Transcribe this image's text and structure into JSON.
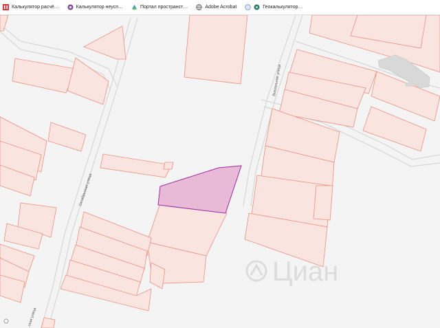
{
  "bookmarks": [
    {
      "label": "Калькулятор расчё…",
      "icon": "red-pdf-icon",
      "color": "#d62f2f"
    },
    {
      "label": "Калькулятор неусп…",
      "icon": "seal-icon",
      "color": "#7a4a8a"
    },
    {
      "label": "Портал пространст…",
      "icon": "cadastre-portal-icon",
      "color": "#3aa0c8"
    },
    {
      "label": "Adobe Acrobat",
      "icon": "globe-icon",
      "color": "#5f6368"
    },
    {
      "label": "Геокалькулятор…",
      "icon": "geocalc-icon",
      "color": "#2e7d6b"
    }
  ],
  "map": {
    "streets": [
      {
        "label": "Октябрьская улица"
      },
      {
        "label": "Вокзальная улица"
      },
      {
        "label": "…ская улица"
      }
    ],
    "watermark": "Циан",
    "colors": {
      "parcel_fill": "#f9e4e0",
      "parcel_stroke": "#ee8e7e",
      "selected_fill": "#e8bad8",
      "selected_stroke": "#9b2c9e",
      "building": "#d8d8d8",
      "road_edge": "#d6d6d6",
      "background": "#f4f4f4"
    }
  }
}
